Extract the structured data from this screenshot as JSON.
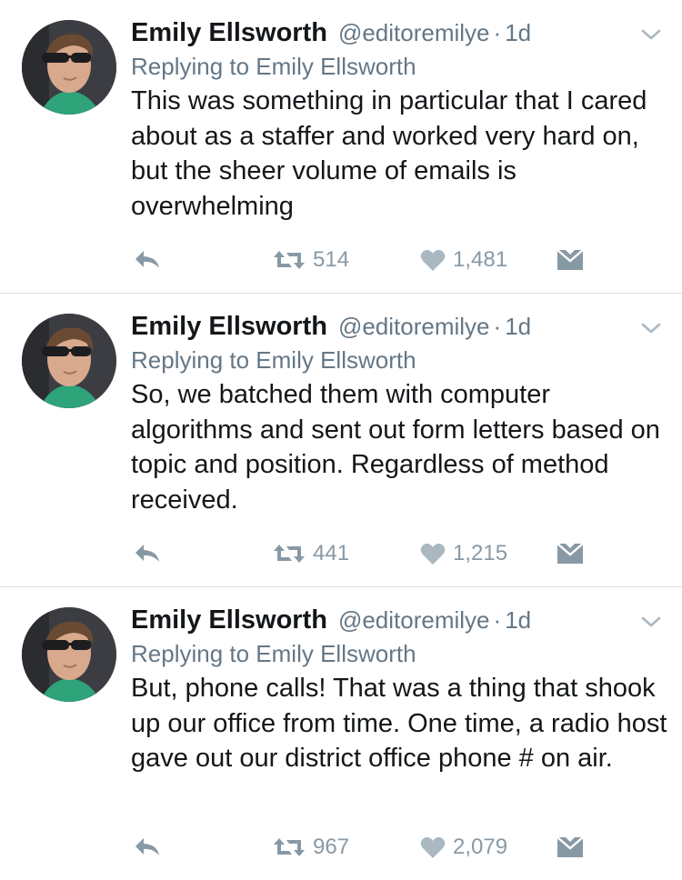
{
  "tweets": [
    {
      "name": "Emily Ellsworth",
      "handle": "@editoremilye",
      "separator": "·",
      "time": "1d",
      "reply_to": "Replying to Emily Ellsworth",
      "text": "This was something in particular that I cared about as a staffer and worked very hard on, but the sheer volume of emails is overwhelming",
      "retweets": "514",
      "likes": "1,481"
    },
    {
      "name": "Emily Ellsworth",
      "handle": "@editoremilye",
      "separator": "·",
      "time": "1d",
      "reply_to": "Replying to Emily Ellsworth",
      "text": "So, we batched them with computer algorithms and sent out form letters based on topic and position. Regardless of method received.",
      "retweets": "441",
      "likes": "1,215"
    },
    {
      "name": "Emily Ellsworth",
      "handle": "@editoremilye",
      "separator": "·",
      "time": "1d",
      "reply_to": "Replying to Emily Ellsworth",
      "text": "But, phone calls! That was a thing that shook up our office from time. One time, a radio host gave out our district office phone # on air.",
      "retweets": "967",
      "likes": "2,079"
    }
  ],
  "icons": {
    "reply": "reply-arrow-icon",
    "retweet": "retweet-icon",
    "like": "heart-icon",
    "dm": "envelope-icon",
    "menu": "chevron-down-icon"
  },
  "colors": {
    "text": "#14171a",
    "secondary": "#657786",
    "action": "#8899a6",
    "divider": "#d9dee3"
  }
}
